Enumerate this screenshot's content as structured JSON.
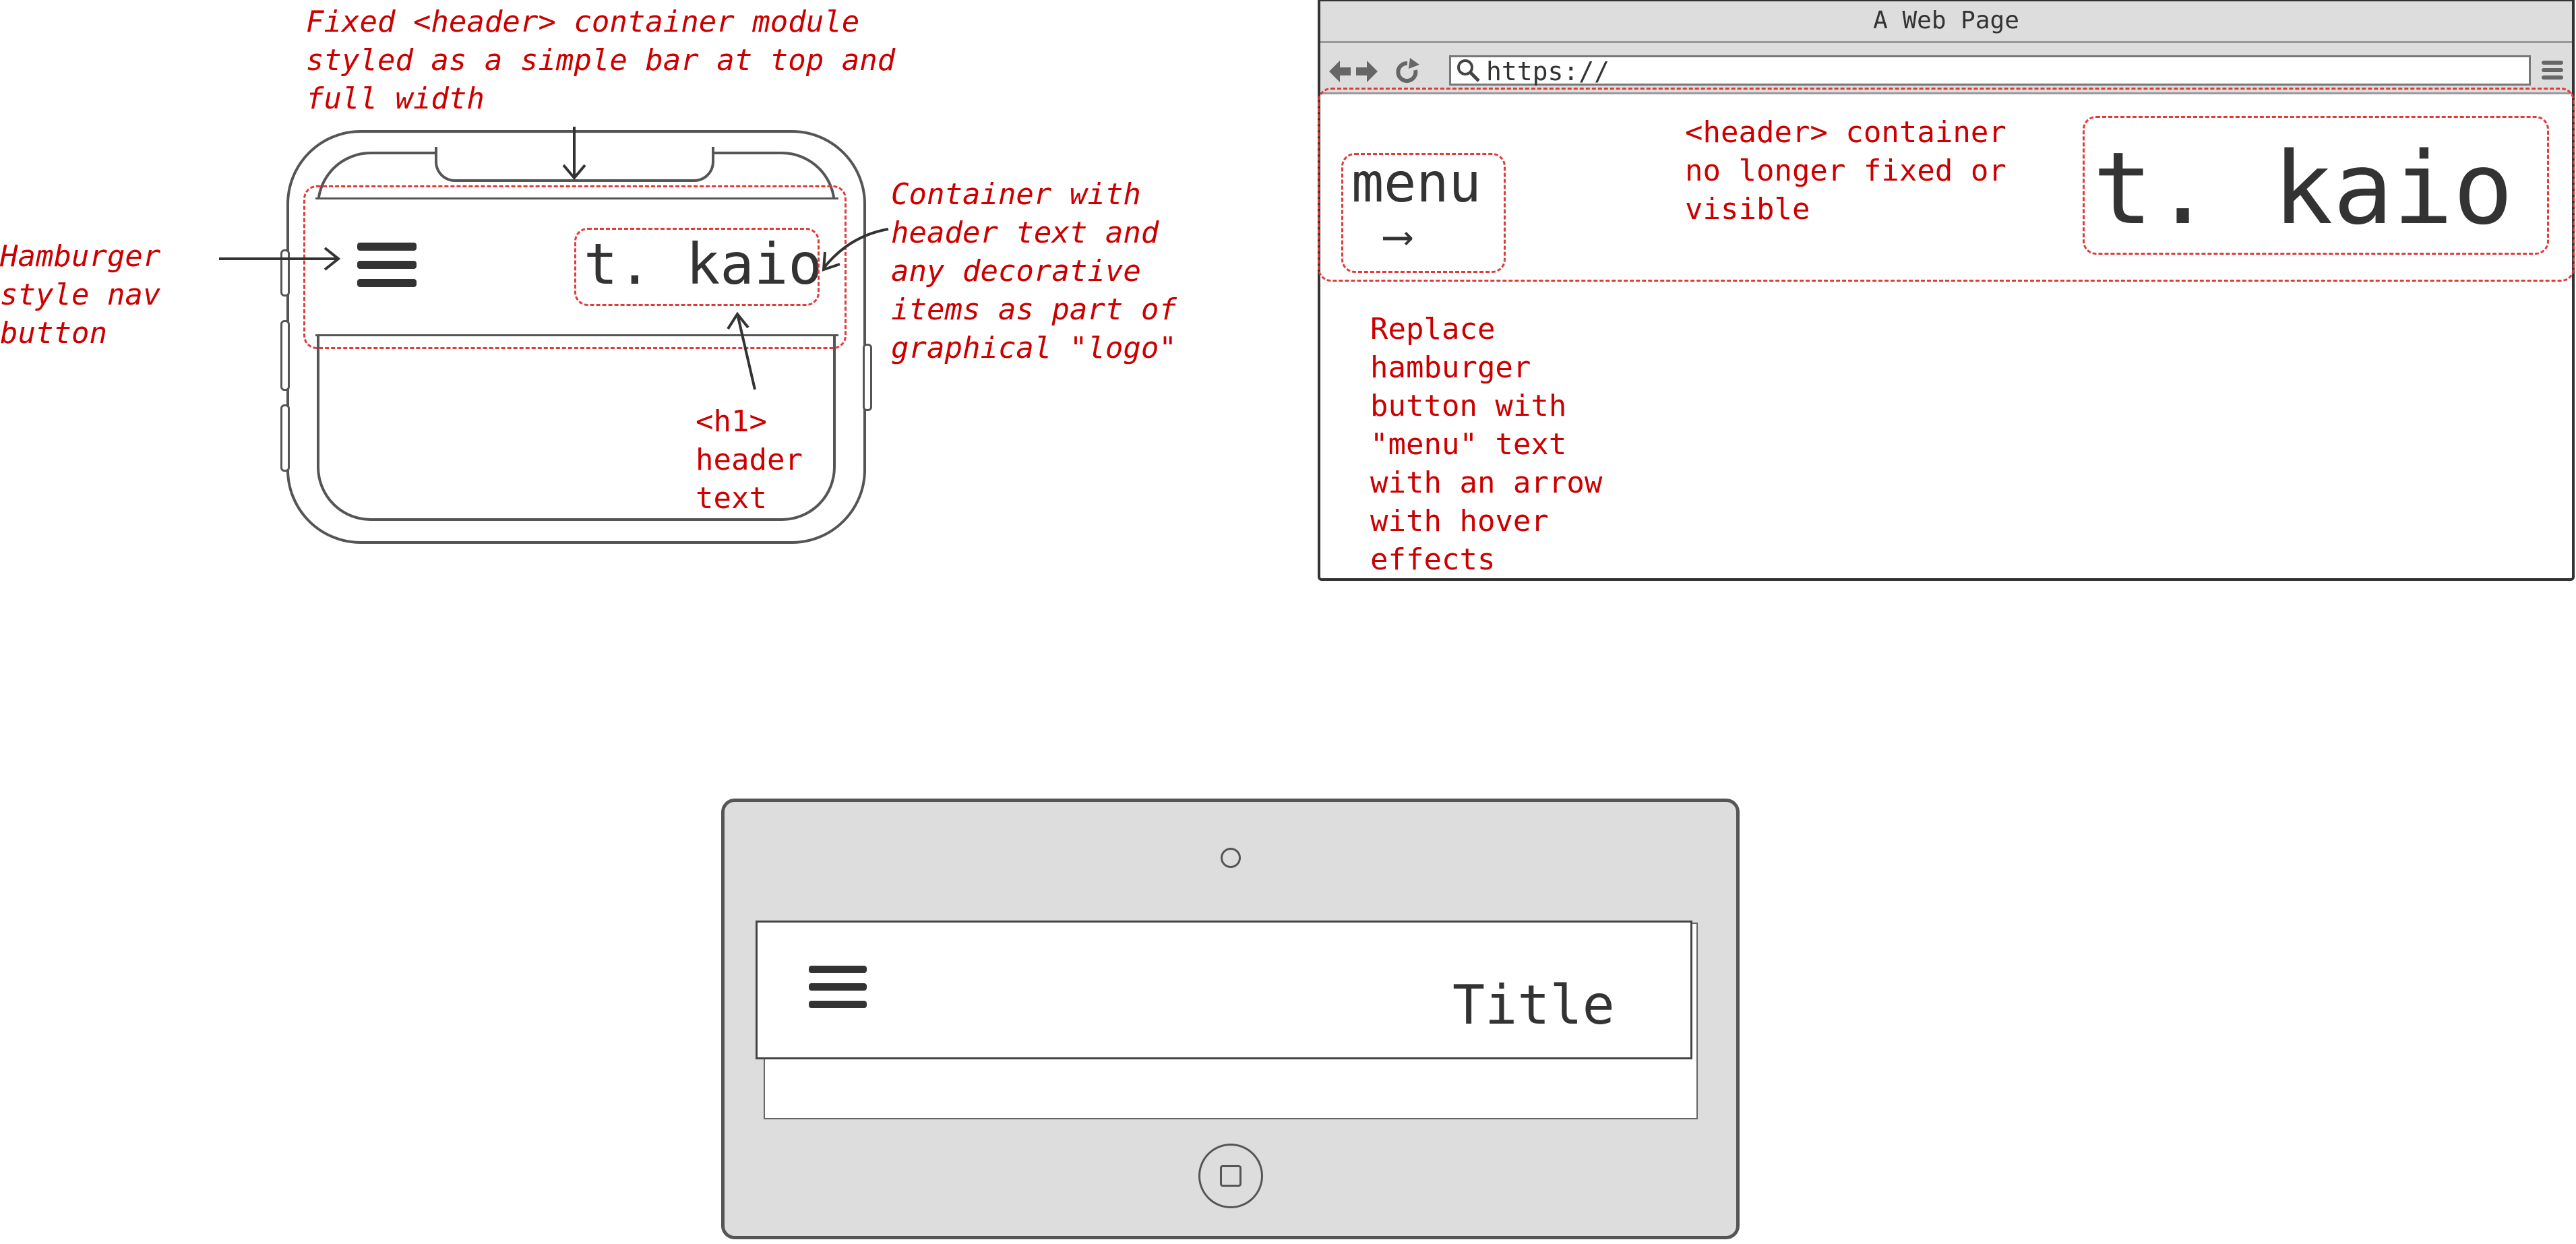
{
  "phone": {
    "annotation_header": "Fixed <header> container module\nstyled as a simple bar at top and\nfull width",
    "annotation_hamburger": "Hamburger\nstyle nav\nbutton",
    "annotation_logo_container": "Container with\nheader text and\nany decorative\nitems as part of\ngraphical \"logo\"",
    "annotation_h1": "<h1>\nheader\ntext",
    "logo_text": "t. kaio",
    "hamburger_icon": "hamburger-menu-icon"
  },
  "browser": {
    "window_title": "A Web Page",
    "url": "https://",
    "nav_icons": [
      "back-arrow-icon",
      "forward-arrow-icon",
      "reload-icon",
      "search-icon",
      "browser-menu-icon"
    ],
    "menu_label": "menu",
    "menu_arrow": "⟶",
    "annotation_header": "<header> container\nno longer fixed or\nvisible",
    "annotation_menu": "Replace\nhamburger\nbutton with\n\"menu\" text\nwith an arrow\nwith hover\neffects",
    "logo_text": "t. kaio"
  },
  "tablet": {
    "title": "Title",
    "hamburger_icon": "hamburger-menu-icon"
  },
  "colors": {
    "annotation": "#cc0000",
    "dashed_outline": "#e03b3b",
    "device_outline": "#555555",
    "tablet_body": "#dddddd",
    "browser_chrome": "#dddddd",
    "text": "#333333"
  }
}
